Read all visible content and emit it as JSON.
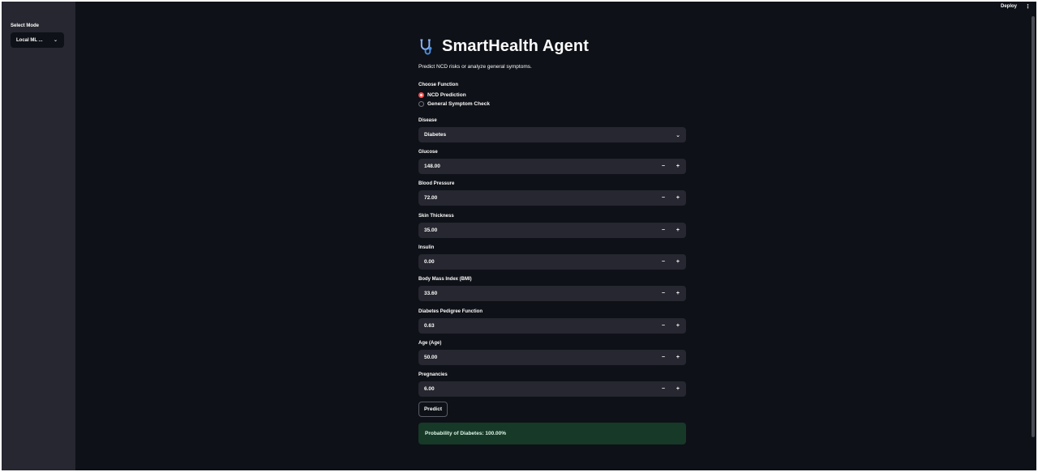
{
  "header": {
    "deploy_label": "Deploy",
    "menu_icon": "kebab-menu-icon"
  },
  "sidebar": {
    "mode_label": "Select Mode",
    "mode_value": "Local ML ..."
  },
  "app": {
    "icon": "stethoscope-icon",
    "title": "SmartHealth Agent",
    "subtitle": "Predict NCD risks or analyze general symptoms."
  },
  "function": {
    "label": "Choose Function",
    "options": [
      {
        "label": "NCD Prediction",
        "selected": true
      },
      {
        "label": "General Symptom Check",
        "selected": false
      }
    ]
  },
  "disease": {
    "label": "Disease",
    "value": "Diabetes"
  },
  "fields": [
    {
      "label": "Glucose",
      "value": "148.00"
    },
    {
      "label": "Blood Pressure",
      "value": "72.00"
    },
    {
      "label": "Skin Thickness",
      "value": "35.00"
    },
    {
      "label": "Insulin",
      "value": "0.00"
    },
    {
      "label": "Body Mass Index (BMI)",
      "value": "33.60"
    },
    {
      "label": "Diabetes Pedigree Function",
      "value": "0.63"
    },
    {
      "label": "Age (Age)",
      "value": "50.00"
    },
    {
      "label": "Pregnancies",
      "value": "6.00"
    }
  ],
  "stepper": {
    "minus": "−",
    "plus": "+"
  },
  "predict_label": "Predict",
  "result_text": "Probability of Diabetes: 100.00%",
  "colors": {
    "accent": "#ff4b4b",
    "success_bg": "#173928",
    "background": "#0e1117",
    "sidebar": "#262730"
  }
}
